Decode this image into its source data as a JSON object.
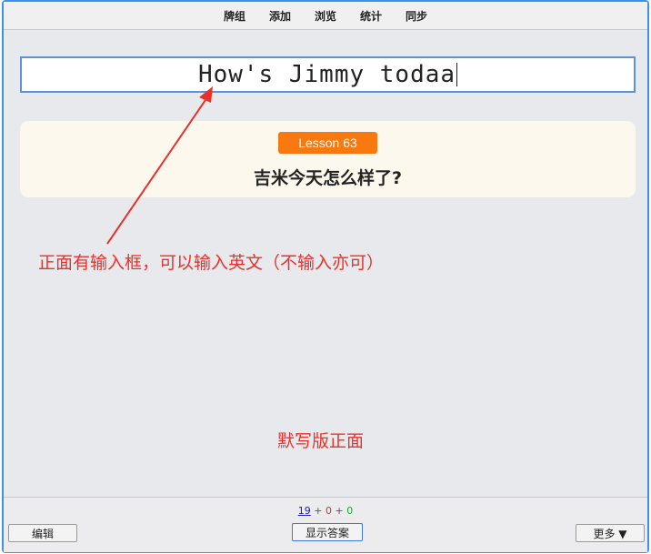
{
  "topbar": {
    "items": [
      "牌组",
      "添加",
      "浏览",
      "统计",
      "同步"
    ]
  },
  "typein": {
    "value": "How's Jimmy todaa"
  },
  "card": {
    "lesson": "Lesson 63",
    "question": "吉米今天怎么样了?"
  },
  "annotations": {
    "typein_note": "正面有输入框，可以输入英文（不输入亦可）",
    "page_note": "默写版正面"
  },
  "bottombar": {
    "counts": {
      "new": "19",
      "sep1": " + ",
      "learn": "0",
      "sep2": " + ",
      "due": "0"
    },
    "edit_label": "编辑",
    "show_answer_label": "显示答案",
    "more_label": "更多 ▼"
  },
  "colors": {
    "frame_border": "#3c92e6",
    "lesson_badge": "#f7790f",
    "annotation": "#e8312a"
  }
}
